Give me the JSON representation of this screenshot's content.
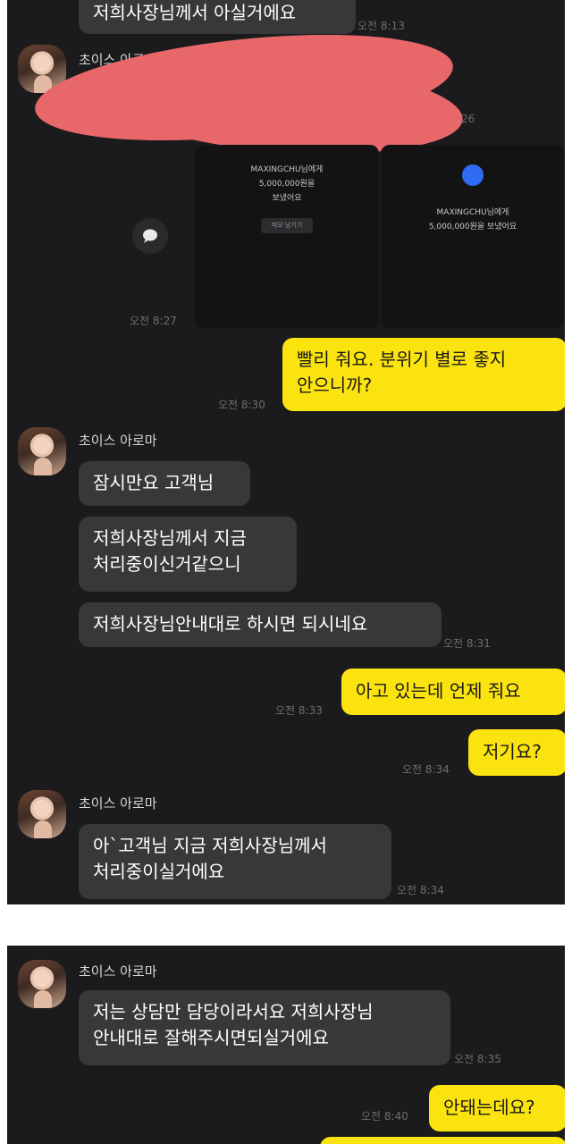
{
  "chat": {
    "sender_name": "초이스 아로마",
    "sender_name_partial": "초이스 아로마",
    "messages": {
      "m0": {
        "text": "저희사장님께서 아실거에요",
        "time": "오전 8:13"
      },
      "transfer_time_partial": "26",
      "transfer_card_1": {
        "line1": "MAXINGCHU님에게",
        "line2": "5,000,000원을",
        "line3": "보냈어요",
        "button": "메모 남기기"
      },
      "transfer_card_2": {
        "line1": "MAXINGCHU님에게",
        "line2": "5,000,000원을 보냈어요"
      },
      "transfer_time": "오전 8:27",
      "m1": {
        "line1": "빨리 줘요. 분위기 별로 좋지",
        "line2": "안으니까?",
        "time": "오전 8:30"
      },
      "m2": {
        "text": "잠시만요 고객님"
      },
      "m3": {
        "line1": "저희사장님께서 지금",
        "line2": "처리중이신거같으니"
      },
      "m4": {
        "text": "저희사장님안내대로 하시면 되시네요",
        "time": "오전 8:31"
      },
      "m5": {
        "text": "아고 있는데 언제 줘요",
        "time": "오전 8:33"
      },
      "m6": {
        "text": "저기요?",
        "time": "오전 8:34"
      },
      "m7": {
        "line1": "아`고객님 지금 저희사장님께서",
        "line2": "처리중이실거에요",
        "time": "오전 8:34"
      },
      "m8": {
        "line1": "저는 상담만 담당이라서요 저희사장님",
        "line2": "안내대로 잘해주시면되실거에요",
        "time": "오전 8:35"
      },
      "m9": {
        "text": "안돼는데요?",
        "time": "오전 8:40"
      }
    }
  },
  "colors": {
    "background": "#1b1b1d",
    "incoming_bubble": "#38383b",
    "outgoing_bubble": "#fbe30f",
    "redaction": "#e8686a",
    "transfer_dot": "#2f6cf3"
  },
  "icons": {
    "chat_bubble": "speech-bubble-icon"
  }
}
